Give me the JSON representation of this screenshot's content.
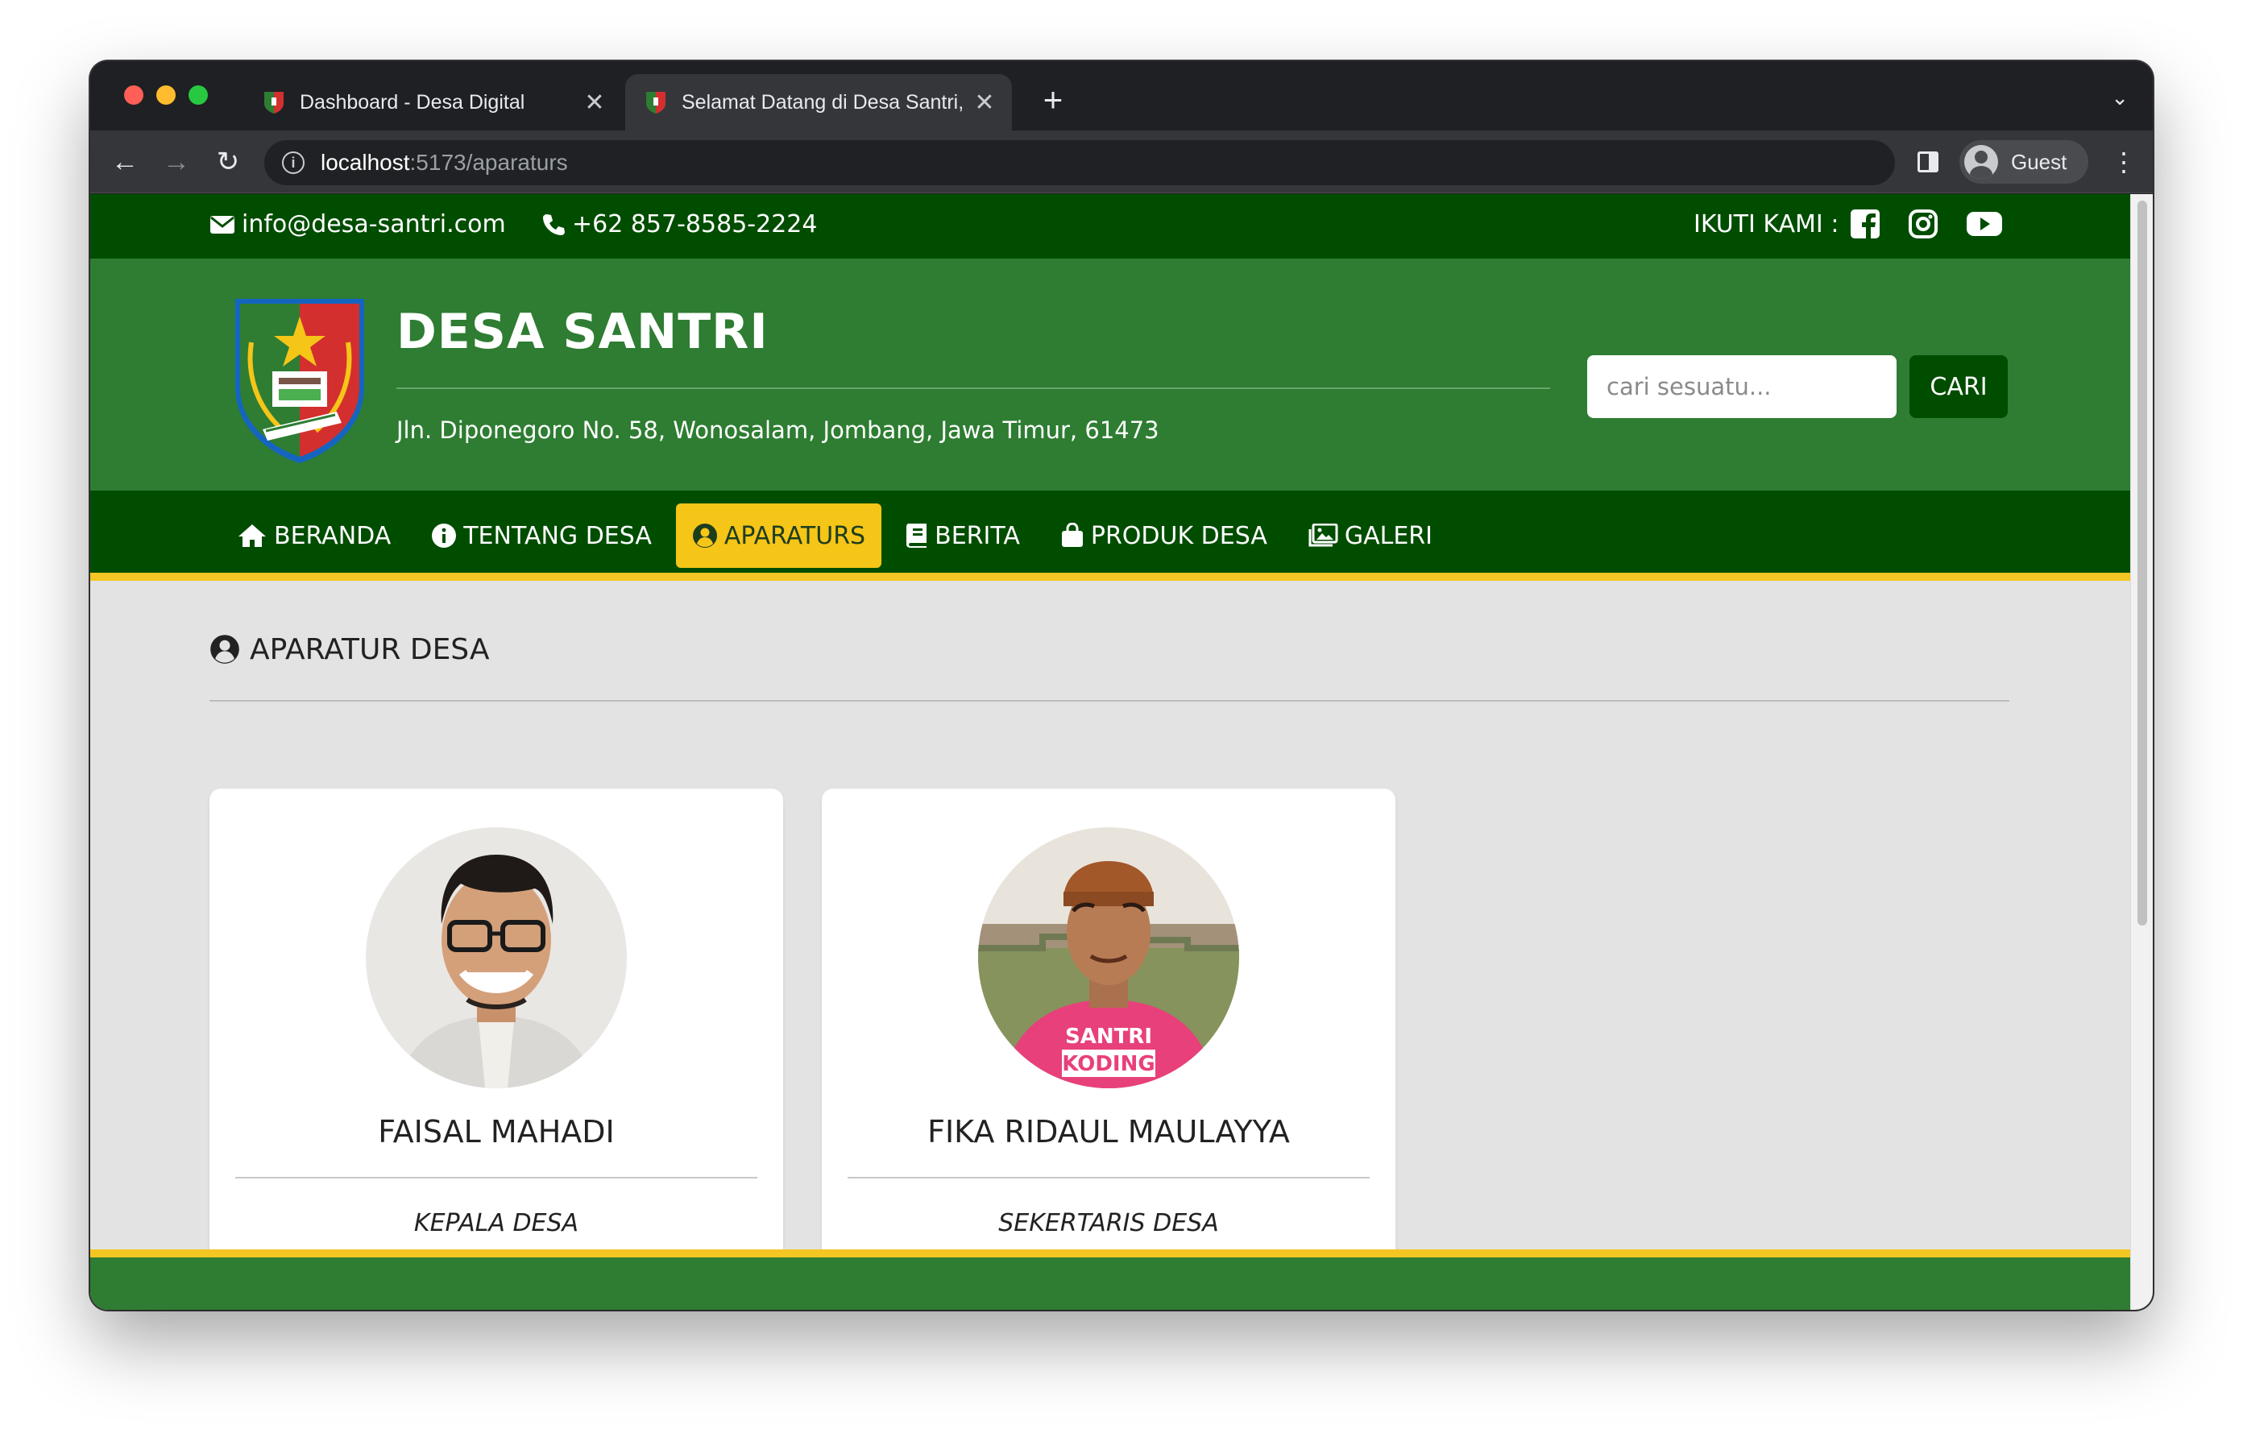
{
  "browser": {
    "tabs": [
      {
        "title": "Dashboard - Desa Digital"
      },
      {
        "title": "Selamat Datang di Desa Santri, Kabupaten Jombang"
      }
    ],
    "url_host": "localhost",
    "url_path": ":5173/aparaturs",
    "profile_name": "Guest"
  },
  "topbar": {
    "email": "info@desa-santri.com",
    "phone": "+62 857-8585-2224",
    "follow_label": "IKUTI KAMI :"
  },
  "header": {
    "brand": "DESA SANTRI",
    "address": "Jln. Diponegoro No. 58, Wonosalam, Jombang, Jawa Timur, 61473",
    "search_placeholder": "cari sesuatu...",
    "search_button": "CARI"
  },
  "menu": {
    "items": [
      {
        "label": "BERANDA",
        "icon": "home-icon"
      },
      {
        "label": "TENTANG DESA",
        "icon": "info-icon"
      },
      {
        "label": "APARATURS",
        "icon": "user-circle-icon",
        "active": true
      },
      {
        "label": "BERITA",
        "icon": "book-icon"
      },
      {
        "label": "PRODUK DESA",
        "icon": "shopping-bag-icon"
      },
      {
        "label": "GALERI",
        "icon": "images-icon"
      }
    ]
  },
  "section": {
    "title": "APARATUR DESA"
  },
  "aparaturs": [
    {
      "name": "FAISAL MAHADI",
      "role": "KEPALA DESA"
    },
    {
      "name": "FIKA RIDAUL MAULAYYA",
      "role": "SEKERTARIS DESA"
    }
  ],
  "colors": {
    "dark_green": "#004d00",
    "green": "#2e7d32",
    "accent_yellow": "#f5c518",
    "page_bg": "#e3e3e3"
  }
}
